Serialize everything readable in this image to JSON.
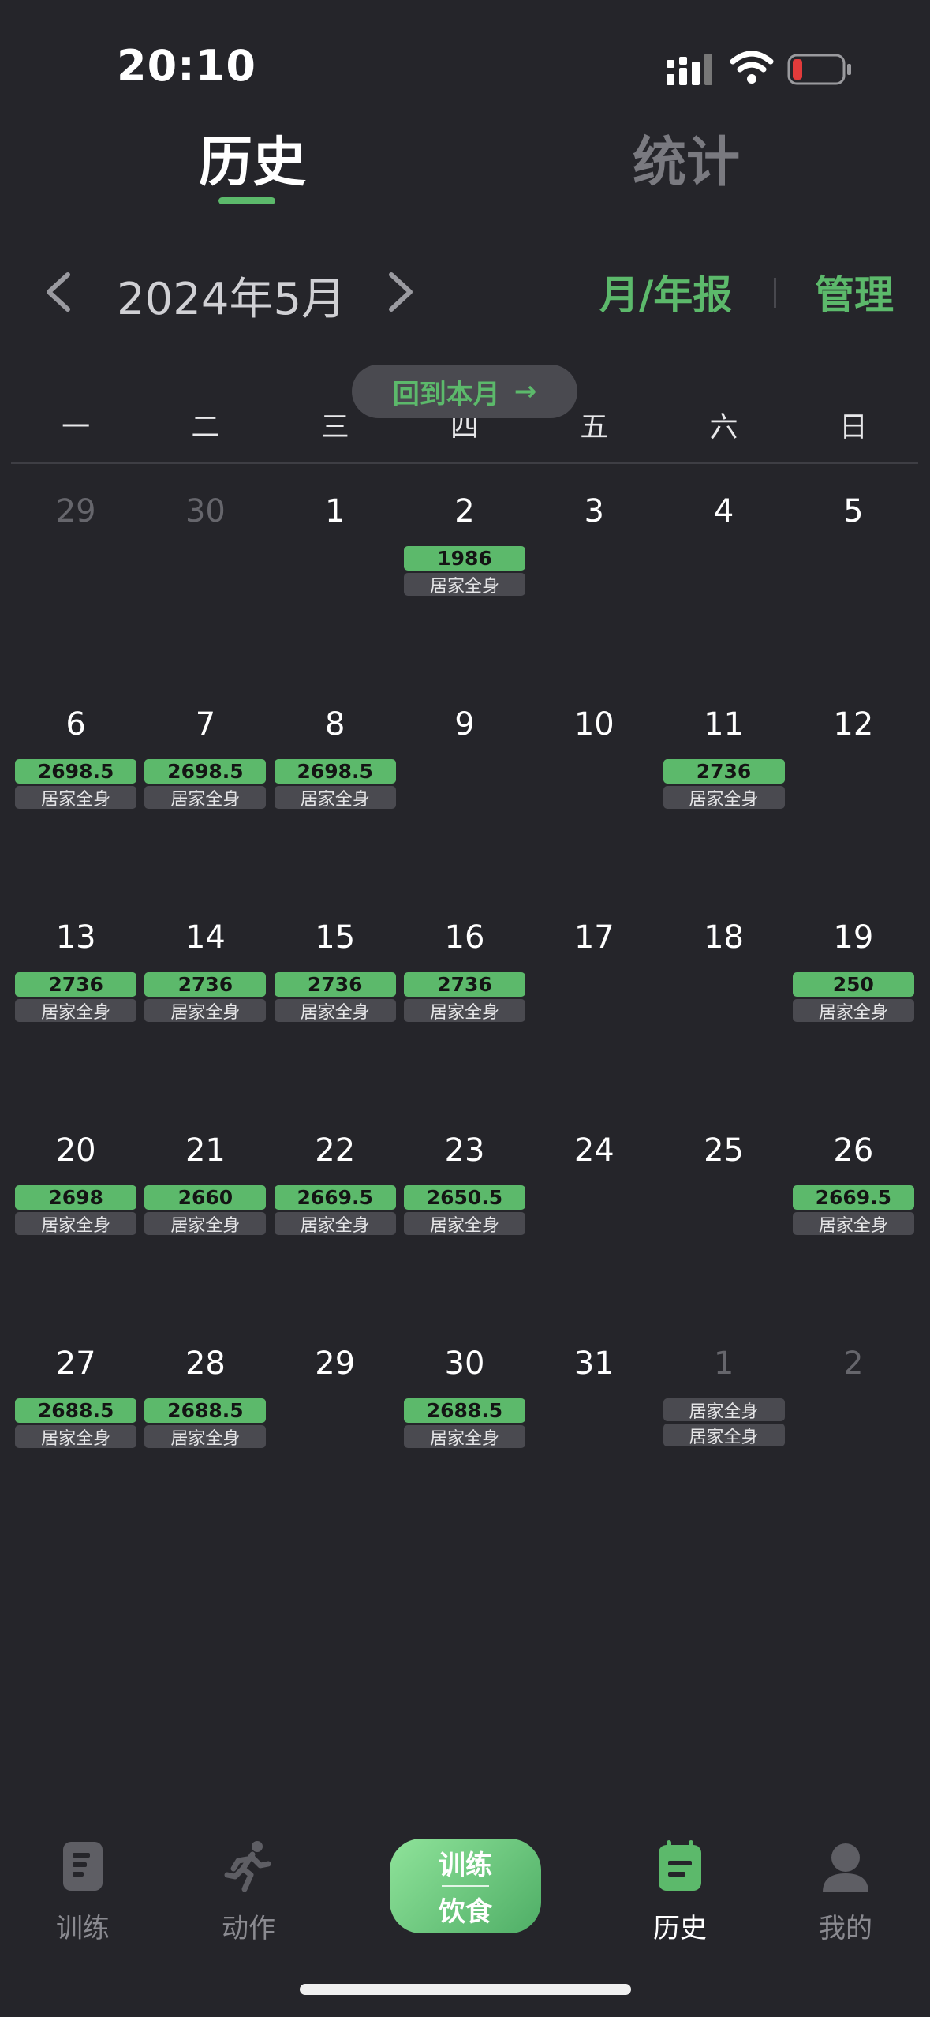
{
  "status_bar": {
    "time": "20:10"
  },
  "top_tabs": [
    {
      "label": "历史",
      "active": true
    },
    {
      "label": "统计",
      "active": false
    }
  ],
  "month_nav": {
    "label": "2024年5月",
    "report_label": "月/年报",
    "manage_label": "管理"
  },
  "back_to_month": {
    "label": "回到本月",
    "arrow": "→"
  },
  "weekdays": [
    "一",
    "二",
    "三",
    "四",
    "五",
    "六",
    "日"
  ],
  "weeks": [
    [
      {
        "day": "29",
        "muted": true,
        "tags": []
      },
      {
        "day": "30",
        "muted": true,
        "tags": []
      },
      {
        "day": "1",
        "tags": []
      },
      {
        "day": "2",
        "tags": [
          {
            "type": "cal",
            "text": "1986"
          },
          {
            "type": "label",
            "text": "居家全身"
          }
        ]
      },
      {
        "day": "3",
        "tags": []
      },
      {
        "day": "4",
        "tags": []
      },
      {
        "day": "5",
        "tags": []
      }
    ],
    [
      {
        "day": "6",
        "tags": [
          {
            "type": "cal",
            "text": "2698.5"
          },
          {
            "type": "label",
            "text": "居家全身"
          }
        ]
      },
      {
        "day": "7",
        "tags": [
          {
            "type": "cal",
            "text": "2698.5"
          },
          {
            "type": "label",
            "text": "居家全身"
          }
        ]
      },
      {
        "day": "8",
        "tags": [
          {
            "type": "cal",
            "text": "2698.5"
          },
          {
            "type": "label",
            "text": "居家全身"
          }
        ]
      },
      {
        "day": "9",
        "tags": []
      },
      {
        "day": "10",
        "tags": []
      },
      {
        "day": "11",
        "tags": [
          {
            "type": "cal",
            "text": "2736"
          },
          {
            "type": "label",
            "text": "居家全身"
          }
        ]
      },
      {
        "day": "12",
        "tags": []
      }
    ],
    [
      {
        "day": "13",
        "tags": [
          {
            "type": "cal",
            "text": "2736"
          },
          {
            "type": "label",
            "text": "居家全身"
          }
        ]
      },
      {
        "day": "14",
        "tags": [
          {
            "type": "cal",
            "text": "2736"
          },
          {
            "type": "label",
            "text": "居家全身"
          }
        ]
      },
      {
        "day": "15",
        "tags": [
          {
            "type": "cal",
            "text": "2736"
          },
          {
            "type": "label",
            "text": "居家全身"
          }
        ]
      },
      {
        "day": "16",
        "tags": [
          {
            "type": "cal",
            "text": "2736"
          },
          {
            "type": "label",
            "text": "居家全身"
          }
        ]
      },
      {
        "day": "17",
        "tags": []
      },
      {
        "day": "18",
        "tags": []
      },
      {
        "day": "19",
        "tags": [
          {
            "type": "cal",
            "text": "250"
          },
          {
            "type": "label",
            "text": "居家全身"
          }
        ]
      }
    ],
    [
      {
        "day": "20",
        "tags": [
          {
            "type": "cal",
            "text": "2698"
          },
          {
            "type": "label",
            "text": "居家全身"
          }
        ]
      },
      {
        "day": "21",
        "tags": [
          {
            "type": "cal",
            "text": "2660"
          },
          {
            "type": "label",
            "text": "居家全身"
          }
        ]
      },
      {
        "day": "22",
        "tags": [
          {
            "type": "cal",
            "text": "2669.5"
          },
          {
            "type": "label",
            "text": "居家全身"
          }
        ]
      },
      {
        "day": "23",
        "tags": [
          {
            "type": "cal",
            "text": "2650.5"
          },
          {
            "type": "label",
            "text": "居家全身"
          }
        ]
      },
      {
        "day": "24",
        "tags": []
      },
      {
        "day": "25",
        "tags": []
      },
      {
        "day": "26",
        "tags": [
          {
            "type": "cal",
            "text": "2669.5"
          },
          {
            "type": "label",
            "text": "居家全身"
          }
        ]
      }
    ],
    [
      {
        "day": "27",
        "tags": [
          {
            "type": "cal",
            "text": "2688.5"
          },
          {
            "type": "label",
            "text": "居家全身"
          }
        ]
      },
      {
        "day": "28",
        "tags": [
          {
            "type": "cal",
            "text": "2688.5"
          },
          {
            "type": "label",
            "text": "居家全身"
          }
        ]
      },
      {
        "day": "29",
        "tags": []
      },
      {
        "day": "30",
        "tags": [
          {
            "type": "cal",
            "text": "2688.5"
          },
          {
            "type": "label",
            "text": "居家全身"
          }
        ]
      },
      {
        "day": "31",
        "tags": []
      },
      {
        "day": "1",
        "muted": true,
        "tags": [
          {
            "type": "label",
            "text": "居家全身"
          },
          {
            "type": "label",
            "text": "居家全身"
          }
        ]
      },
      {
        "day": "2",
        "muted": true,
        "tags": []
      }
    ]
  ],
  "tab_bar": {
    "items": [
      {
        "label": "训练",
        "icon": "clipboard-icon"
      },
      {
        "label": "动作",
        "icon": "running-icon"
      },
      {
        "label": "历史",
        "icon": "calendar-icon",
        "active": true
      },
      {
        "label": "我的",
        "icon": "person-icon"
      }
    ],
    "center": {
      "line1": "训练",
      "line2": "饮食"
    }
  },
  "colors": {
    "background": "#25252a",
    "accent": "#5cb96b",
    "tag_gray": "#4a4a50",
    "muted_text": "#66666c"
  }
}
